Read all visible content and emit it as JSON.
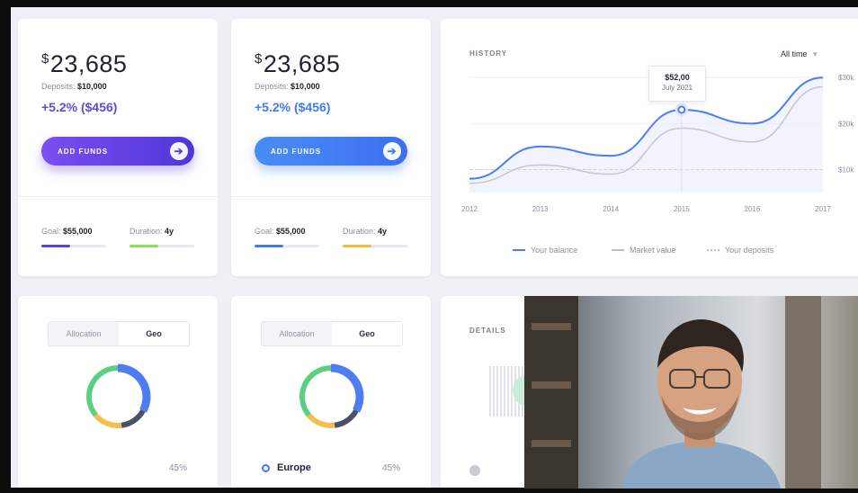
{
  "cards": [
    {
      "currency": "$",
      "balance": "23,685",
      "deposits_label": "Deposits:",
      "deposits_value": "$10,000",
      "change": "+5.2% ($456)",
      "button": "ADD FUNDS",
      "goal_label": "Goal:",
      "goal_value": "$55,000",
      "duration_label": "Duration:",
      "duration_value": "4y",
      "goal_progress": 0.45,
      "duration_progress": 0.45
    },
    {
      "currency": "$",
      "balance": "23,685",
      "deposits_label": "Deposits:",
      "deposits_value": "$10,000",
      "change": "+5.2% ($456)",
      "button": "ADD FUNDS",
      "goal_label": "Goal:",
      "goal_value": "$55,000",
      "duration_label": "Duration:",
      "duration_value": "4y",
      "goal_progress": 0.45,
      "duration_progress": 0.45
    }
  ],
  "history": {
    "title": "HISTORY",
    "range": "All time",
    "tooltip_value": "$52,00",
    "tooltip_date": "July 2021",
    "legend": [
      "Your balance",
      "Market value",
      "Your deposits"
    ]
  },
  "allocation": [
    {
      "tab_allocation": "Allocation",
      "tab_geo": "Geo",
      "region": "",
      "percent": "45%"
    },
    {
      "tab_allocation": "Allocation",
      "tab_geo": "Geo",
      "region": "Europe",
      "percent": "45%"
    }
  ],
  "details": {
    "title": "DETAILS"
  },
  "colors": {
    "purple": "#5b3fe0",
    "blue": "#3f7cf2",
    "green": "#8be05a",
    "yellow": "#f4bb35",
    "donut_blue": "#4d7cf3",
    "donut_green": "#5ccf83",
    "donut_yellow": "#f1c04a",
    "donut_dark": "#4b5068"
  },
  "chart_data": {
    "type": "line",
    "title": "HISTORY",
    "x": [
      "2012",
      "2013",
      "2014",
      "2015",
      "2016",
      "2017"
    ],
    "ytick_labels": [
      "$10k",
      "$20k",
      "$30k"
    ],
    "ylim": [
      5,
      32
    ],
    "series": [
      {
        "name": "Your balance",
        "values": [
          8,
          15,
          13,
          23,
          20,
          30
        ]
      },
      {
        "name": "Market value",
        "values": [
          7,
          11,
          9,
          19,
          16,
          28
        ]
      },
      {
        "name": "Your deposits",
        "values": [
          10,
          10,
          10,
          10,
          10,
          10
        ]
      }
    ],
    "legend": "bottom"
  }
}
